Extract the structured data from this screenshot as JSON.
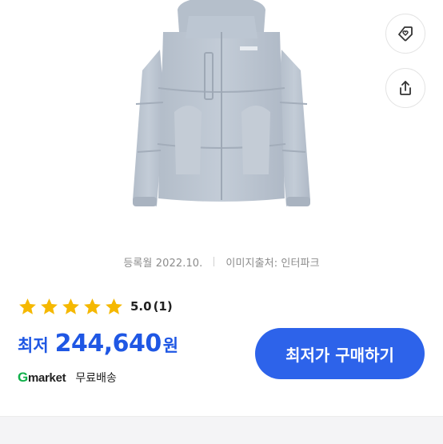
{
  "product": {
    "image_alt": "light blue-gray hooded puffer jacket",
    "colors": {
      "jacket": "#b9c3cf",
      "jacket_shade": "#a3adba"
    }
  },
  "actions": {
    "favorite_icon": "heart-tag-icon",
    "share_icon": "share-icon"
  },
  "meta": {
    "registered": "등록월 2022.10.",
    "source": "이미지출처: 인터파크"
  },
  "rating": {
    "stars": 5,
    "star_color": "#f5b800",
    "score": "5.0",
    "count": "(1)"
  },
  "price": {
    "label": "최저",
    "value": "244,640",
    "unit": "원",
    "color": "#1f57e4"
  },
  "shop": {
    "logo_g": "G",
    "logo_rest": "market",
    "shipping": "무료배송"
  },
  "cta": {
    "label": "최저가 구매하기",
    "color": "#2d63ea"
  }
}
